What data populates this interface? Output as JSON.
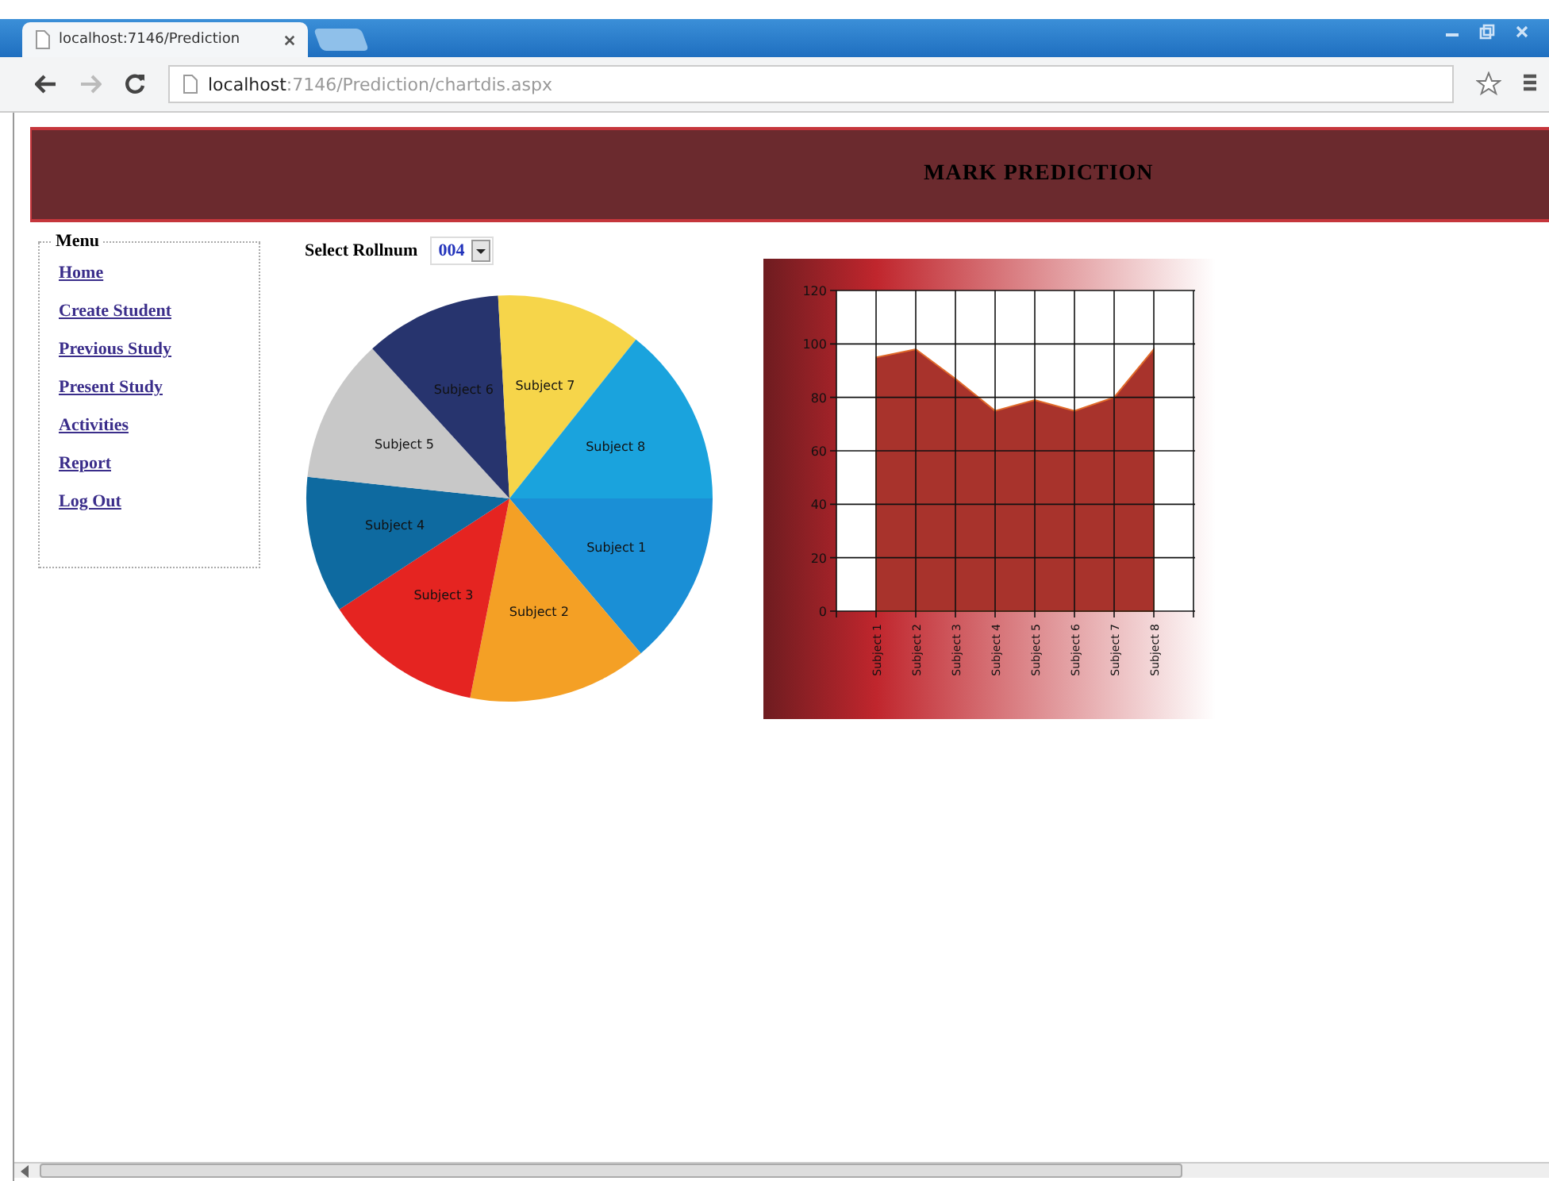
{
  "browser": {
    "tab_title": "localhost:7146/Prediction",
    "url_host": "localhost",
    "url_path": ":7146/Prediction/chartdis.aspx"
  },
  "header": {
    "title": "MARK PREDICTION"
  },
  "menu": {
    "legend": "Menu",
    "items": [
      "Home",
      "Create Student",
      "Previous Study",
      "Present Study",
      "Activities",
      "Report",
      "Log Out"
    ]
  },
  "rollnum": {
    "label": "Select Rollnum",
    "value": "004"
  },
  "pie": {
    "chart_data": {
      "type": "pie",
      "categories": [
        "Subject 1",
        "Subject 2",
        "Subject 3",
        "Subject 4",
        "Subject 5",
        "Subject 6",
        "Subject 7",
        "Subject 8"
      ],
      "values": [
        13.8,
        14.3,
        12.7,
        10.9,
        11.5,
        10.9,
        11.6,
        14.3
      ],
      "colors": [
        "#1a8fd6",
        "#f4a025",
        "#e52421",
        "#0e6aa0",
        "#c8c8c8",
        "#27346e",
        "#f6d54a",
        "#1aa3dd"
      ]
    }
  },
  "area": {
    "chart_data": {
      "type": "area",
      "categories": [
        "Subject 1",
        "Subject 2",
        "Subject 3",
        "Subject 4",
        "Subject 5",
        "Subject 6",
        "Subject 7",
        "Subject 8"
      ],
      "series": [
        {
          "color": "#a8332c",
          "values": [
            95,
            98,
            87,
            75,
            79,
            75,
            80,
            98
          ]
        }
      ],
      "grid": true,
      "ylim": [
        0,
        120
      ],
      "yticks": [
        0,
        20,
        40,
        60,
        80,
        100,
        120
      ]
    }
  }
}
